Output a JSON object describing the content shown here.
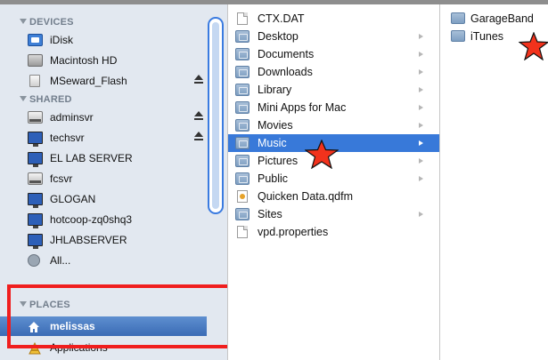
{
  "sidebar": {
    "sections": {
      "devices": "DEVICES",
      "shared": "SHARED",
      "places": "PLACES"
    },
    "devices": [
      "iDisk",
      "Macintosh HD",
      "MSeward_Flash"
    ],
    "shared": [
      "adminsvr",
      "techsvr",
      "EL LAB SERVER",
      "fcsvr",
      "GLOGAN",
      "hotcoop-zq0shq3",
      "JHLABSERVER",
      "All..."
    ],
    "places": [
      "melissas",
      "Applications"
    ]
  },
  "column1": {
    "items": [
      "CTX.DAT",
      "Desktop",
      "Documents",
      "Downloads",
      "Library",
      "Mini Apps for Mac",
      "Movies",
      "Music",
      "Pictures",
      "Public",
      "Quicken Data.qdfm",
      "Sites",
      "vpd.properties"
    ],
    "selected": "Music"
  },
  "column2": {
    "items": [
      "GarageBand",
      "iTunes"
    ]
  },
  "colors": {
    "selection": "#3879d9",
    "sidebar_bg": "#e2e8f0",
    "highlight_box": "#f01e1e",
    "star": "#f2321c"
  }
}
